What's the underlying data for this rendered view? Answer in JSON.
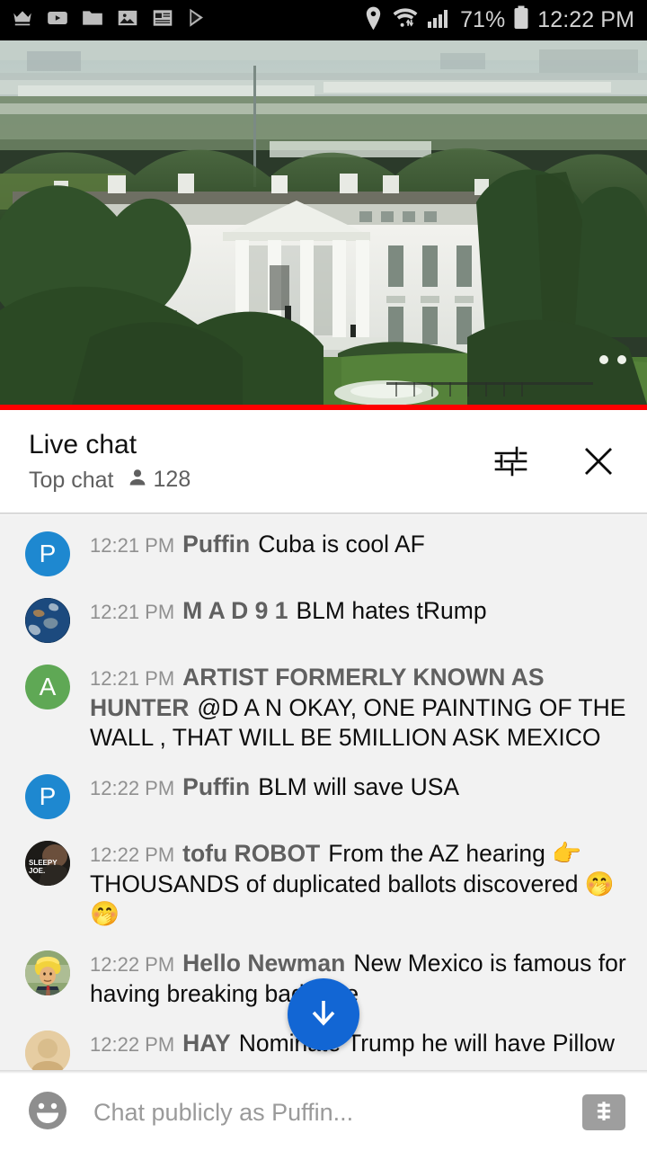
{
  "statusbar": {
    "icons_left": [
      "crown-icon",
      "youtube-icon",
      "folder-icon",
      "photo-icon",
      "news-icon",
      "play-store-icon"
    ],
    "icons_right": [
      "location-icon",
      "wifi-icon",
      "signal-icon",
      "battery-icon"
    ],
    "battery_percent": "71%",
    "time": "12:22 PM"
  },
  "video": {
    "name": "white-house-live-stream",
    "progress_color": "#ff0000"
  },
  "chat_header": {
    "title": "Live chat",
    "subtitle": "Top chat",
    "viewer_count": "128",
    "settings_icon": "chat-settings-icon",
    "close_icon": "close-icon"
  },
  "messages": [
    {
      "time": "12:21 PM",
      "author": "Puffin",
      "text": "Cuba is cool AF",
      "avatar_type": "letter",
      "avatar_letter": "P",
      "avatar_color": "#1e88d0"
    },
    {
      "time": "12:21 PM",
      "author": "M A D 9 1",
      "text": "BLM hates tRump",
      "avatar_type": "earth",
      "avatar_letter": "",
      "avatar_color": "#2b4c7e"
    },
    {
      "time": "12:21 PM",
      "author": "ARTIST FORMERLY KNOWN AS HUNTER",
      "text": "@D A N OKAY, ONE PAINTING OF THE WALL , THAT WILL BE 5MILLION ASK MEXICO",
      "avatar_type": "letter",
      "avatar_letter": "A",
      "avatar_color": "#5fa855"
    },
    {
      "time": "12:22 PM",
      "author": "Puffin",
      "text": "BLM will save USA",
      "avatar_type": "letter",
      "avatar_letter": "P",
      "avatar_color": "#1e88d0"
    },
    {
      "time": "12:22 PM",
      "author": "tofu ROBOT",
      "text": "From the AZ hearing 👉THOUSANDS of duplicated ballots discovered 🤭🤭",
      "avatar_type": "sleepy-joe",
      "avatar_letter": "",
      "avatar_color": "#3a3226"
    },
    {
      "time": "12:22 PM",
      "author": "Hello Newman",
      "text": "New Mexico is famous for having breaking bad  here",
      "avatar_type": "trump",
      "avatar_letter": "",
      "avatar_color": "#8ea36b"
    },
    {
      "time": "12:22 PM",
      "author": "HAY",
      "text": "Nominate Trump  he will have Pillow",
      "avatar_type": "plain",
      "avatar_letter": "",
      "avatar_color": "#e8c89a"
    }
  ],
  "scroll_button": {
    "name": "scroll-to-bottom-button",
    "icon": "arrow-down-icon",
    "color": "#1266d4"
  },
  "composer": {
    "emoji_icon": "emoji-icon",
    "placeholder": "Chat publicly as Puffin...",
    "value": "",
    "superchat_icon": "super-chat-dollar-icon"
  }
}
